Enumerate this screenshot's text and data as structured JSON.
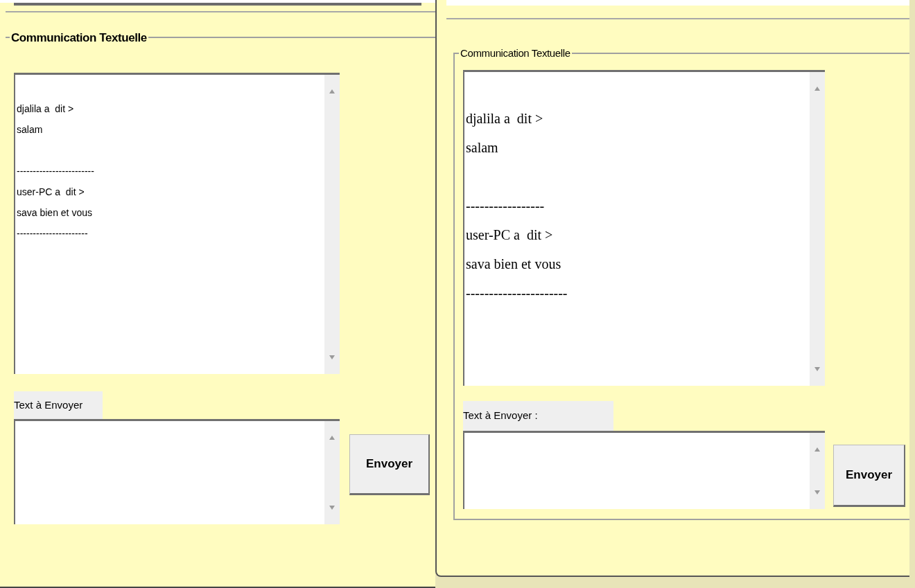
{
  "windows": [
    {
      "kind": "back",
      "group_title": "Communication Textuelle",
      "chat_text": "djalila a  dit >\nsalam\n\n------------------------\nuser-PC a  dit >\nsava bien et vous\n----------------------",
      "input_label": "Text à Envoyer",
      "send_button": "Envoyer"
    },
    {
      "kind": "front",
      "group_title": "Communication Textuelle",
      "chat_text": "djalila a  dit >\nsalam\n\n-----------------\nuser-PC a  dit >\nsava bien et vous\n----------------------",
      "input_label": "Text à Envoyer :",
      "send_button": "Envoyer"
    }
  ]
}
